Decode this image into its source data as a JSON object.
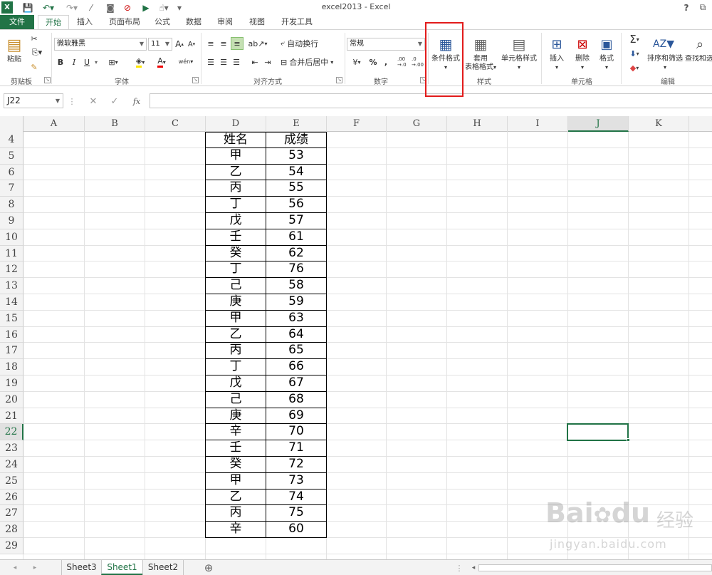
{
  "title_bar": {
    "title": "excel2013 - Excel",
    "help": "?",
    "restore": "⧉"
  },
  "tabs": [
    "文件",
    "开始",
    "插入",
    "页面布局",
    "公式",
    "数据",
    "审阅",
    "视图",
    "开发工具"
  ],
  "ribbon": {
    "clipboard": {
      "group": "剪贴板",
      "paste": "粘贴"
    },
    "font": {
      "group": "字体",
      "font_name": "微软雅黑",
      "font_size": "11",
      "bold": "B",
      "italic": "I",
      "underline": "U",
      "grow": "A",
      "shrink": "A",
      "font_color": "A",
      "phonetic": "wén"
    },
    "alignment": {
      "group": "对齐方式",
      "wrap_text": "自动换行",
      "merge_center": "合并后居中"
    },
    "number": {
      "group": "数字",
      "format": "常规",
      "percent": "%",
      "comma": ",",
      "inc_dec": ".00 →.0",
      "dec_dec": ".0 →.00"
    },
    "styles": {
      "group": "样式",
      "conditional_formatting": "条件格式",
      "format_as_table_1": "套用",
      "format_as_table_2": "表格格式",
      "cell_styles": "单元格样式"
    },
    "cells": {
      "group": "单元格",
      "insert": "插入",
      "delete": "删除",
      "format": "格式"
    },
    "editing": {
      "group": "编辑",
      "sort_filter": "排序和筛选",
      "find_select": "查找和选"
    }
  },
  "formula_bar": {
    "name_box": "J22",
    "cancel": "✕",
    "enter": "✓",
    "fx": "fx",
    "value": ""
  },
  "columns": [
    "A",
    "B",
    "C",
    "D",
    "E",
    "F",
    "G",
    "H",
    "I",
    "J",
    "K"
  ],
  "selected_column": "J",
  "selected_row": "22",
  "rows": [
    "4",
    "5",
    "6",
    "7",
    "8",
    "9",
    "10",
    "11",
    "12",
    "13",
    "14",
    "15",
    "16",
    "17",
    "18",
    "19",
    "20",
    "21",
    "22",
    "23",
    "24",
    "25",
    "26",
    "27",
    "28",
    "29"
  ],
  "table": {
    "header": [
      "姓名",
      "成绩"
    ],
    "records": [
      [
        "甲",
        "53"
      ],
      [
        "乙",
        "54"
      ],
      [
        "丙",
        "55"
      ],
      [
        "丁",
        "56"
      ],
      [
        "戊",
        "57"
      ],
      [
        "壬",
        "61"
      ],
      [
        "癸",
        "62"
      ],
      [
        "丁",
        "76"
      ],
      [
        "己",
        "58"
      ],
      [
        "庚",
        "59"
      ],
      [
        "甲",
        "63"
      ],
      [
        "乙",
        "64"
      ],
      [
        "丙",
        "65"
      ],
      [
        "丁",
        "66"
      ],
      [
        "戊",
        "67"
      ],
      [
        "己",
        "68"
      ],
      [
        "庚",
        "69"
      ],
      [
        "辛",
        "70"
      ],
      [
        "壬",
        "71"
      ],
      [
        "癸",
        "72"
      ],
      [
        "甲",
        "73"
      ],
      [
        "乙",
        "74"
      ],
      [
        "丙",
        "75"
      ],
      [
        "辛",
        "60"
      ]
    ]
  },
  "sheet_tabs": [
    "Sheet3",
    "Sheet1",
    "Sheet2"
  ],
  "active_sheet": "Sheet1",
  "new_sheet": "⊕",
  "watermark": {
    "brand": "Bai",
    "brand2": "du",
    "cn": "经验",
    "url": "jingyan.baidu.com"
  },
  "colors": {
    "excel_green": "#217346",
    "highlight_red": "#e21b1b"
  }
}
